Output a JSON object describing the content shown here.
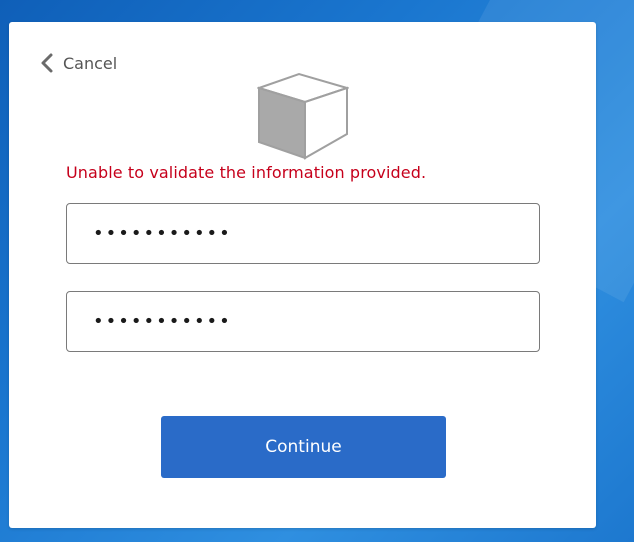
{
  "dialog": {
    "cancel_label": "Cancel",
    "error_message": "Unable to validate the information provided.",
    "field_one_value": "•••••••••••",
    "field_two_value": "•••••••••••",
    "continue_label": "Continue"
  },
  "icons": {
    "back": "chevron-left-icon",
    "product": "cube-icon"
  },
  "colors": {
    "background": "#1a76cf",
    "error": "#c6001b",
    "primary_button": "#2a6bc8",
    "dialog_bg": "#ffffff"
  }
}
